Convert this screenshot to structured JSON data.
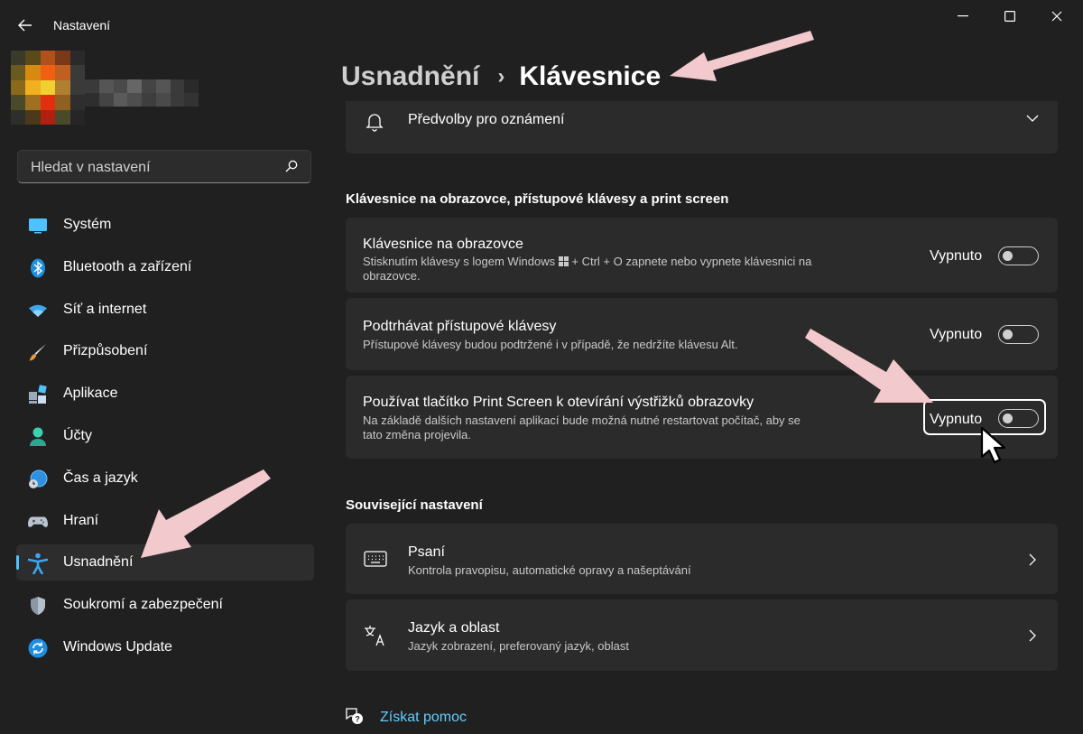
{
  "window": {
    "title": "Nastavení",
    "back_icon": "back-arrow-icon",
    "controls": [
      "minimize",
      "maximize",
      "close"
    ]
  },
  "search": {
    "placeholder": "Hledat v nastavení",
    "icon": "search-icon"
  },
  "sidebar": {
    "items": [
      {
        "label": "Systém",
        "icon": "system-icon",
        "active": false
      },
      {
        "label": "Bluetooth a zařízení",
        "icon": "bluetooth-icon",
        "active": false
      },
      {
        "label": "Síť a internet",
        "icon": "wifi-icon",
        "active": false
      },
      {
        "label": "Přizpůsobení",
        "icon": "brush-icon",
        "active": false
      },
      {
        "label": "Aplikace",
        "icon": "apps-icon",
        "active": false
      },
      {
        "label": "Účty",
        "icon": "account-icon",
        "active": false
      },
      {
        "label": "Čas a jazyk",
        "icon": "time-language-icon",
        "active": false
      },
      {
        "label": "Hraní",
        "icon": "gamepad-icon",
        "active": false
      },
      {
        "label": "Usnadnění",
        "icon": "accessibility-icon",
        "active": true
      },
      {
        "label": "Soukromí a zabezpečení",
        "icon": "shield-icon",
        "active": false
      },
      {
        "label": "Windows Update",
        "icon": "update-icon",
        "active": false
      }
    ]
  },
  "breadcrumb": {
    "parent": "Usnadnění",
    "separator": "›",
    "current": "Klávesnice"
  },
  "notification_card": {
    "label": "Předvolby pro oznámení",
    "icon": "bell-icon"
  },
  "section_keyboard": {
    "heading": "Klávesnice na obrazovce, přístupové klávesy a print screen",
    "settings": [
      {
        "title": "Klávesnice na obrazovce",
        "desc_line1": "Stisknutím klávesy s logem Windows",
        "desc_line1_rest": "+ Ctrl + O zapnete nebo vypnete klávesnici na",
        "desc_line2": "obrazovce.",
        "state": "Vypnuto",
        "on": false
      },
      {
        "title": "Podtrhávat přístupové klávesy",
        "desc_line1": "Přístupové klávesy budou podtržené i v případě, že nedržíte klávesu Alt.",
        "state": "Vypnuto",
        "on": false
      },
      {
        "title": "Používat tlačítko Print Screen k otevírání výstřižků obrazovky",
        "desc_line1": "Na základě dalších nastavení aplikací bude možná nutné restartovat počítač, aby se",
        "desc_line2": "tato změna projevila.",
        "state": "Vypnuto",
        "on": false,
        "focused": true
      }
    ]
  },
  "section_related": {
    "heading": "Související nastavení",
    "links": [
      {
        "title": "Psaní",
        "desc": "Kontrola pravopisu, automatické opravy a našeptávání",
        "icon": "keyboard-icon"
      },
      {
        "title": "Jazyk a oblast",
        "desc": "Jazyk zobrazení, preferovaný jazyk, oblast",
        "icon": "language-icon"
      }
    ]
  },
  "help": {
    "label": "Získat pomoc",
    "icon": "help-icon"
  },
  "colors": {
    "background": "#202020",
    "card": "#2b2b2b",
    "accent": "#4cc2ff",
    "link": "#60cdff",
    "annotation_arrow": "#f2c9cc"
  }
}
